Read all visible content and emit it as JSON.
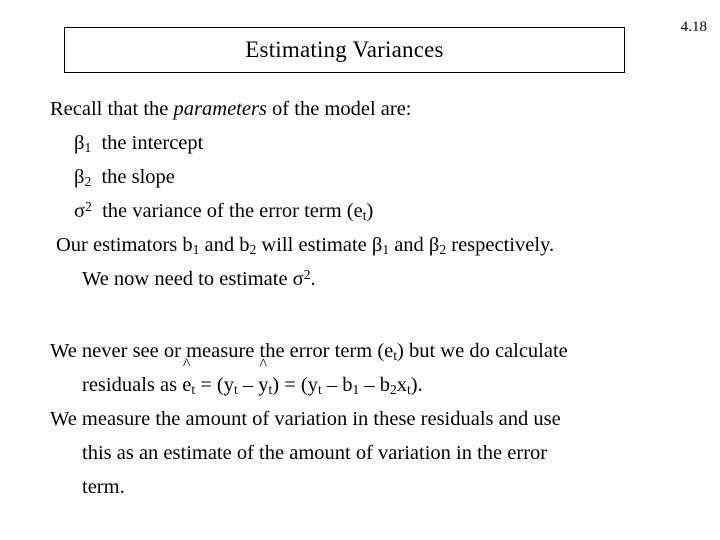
{
  "slide": {
    "number": "4.18",
    "title": "Estimating Variances",
    "background_color": "#ffffff",
    "text_color": "#000000",
    "title_border_color": "#000000"
  },
  "body": {
    "block1": {
      "line1_a": "Recall that the ",
      "line1_italic": "parameters",
      "line1_b": " of the model are:",
      "bullet1": {
        "symbol": "β",
        "sub": "1",
        "text": "the intercept"
      },
      "bullet2": {
        "symbol": "β",
        "sub": "2",
        "text": "the slope"
      },
      "bullet3": {
        "symbol": "σ",
        "sup": "2",
        "text_a": "the variance of the error term (e",
        "sub": "t",
        "text_b": ")"
      },
      "line5_a": "Our estimators b",
      "line5_sub1": "1",
      "line5_b": " and b",
      "line5_sub2": "2",
      "line5_c": " will estimate β",
      "line5_sub3": "1",
      "line5_d": " and β",
      "line5_sub4": "2",
      "line5_e": " respectively.",
      "line6_a": "We now need to estimate σ",
      "line6_sup": "2",
      "line6_b": "."
    },
    "block2": {
      "line1_a": "We never see or measure the error term (e",
      "line1_sub": "t",
      "line1_b": ") but we do calculate",
      "line2_a": "residuals as ",
      "line2_hat1_base": "e",
      "line2_hat1_mark": "^",
      "line2_hat1_sub": "t",
      "line2_b": " = (y",
      "line2_sub1": "t",
      "line2_c": " – ",
      "line2_hat2_base": "y",
      "line2_hat2_mark": "^",
      "line2_hat2_sub": "t",
      "line2_d": ") = (y",
      "line2_sub2": "t",
      "line2_e": " – b",
      "line2_sub3": "1",
      "line2_f": " – b",
      "line2_sub4": "2",
      "line2_g": "x",
      "line2_sub5": "t",
      "line2_h": ").",
      "line3": "We measure the amount of variation in these residuals and use",
      "line4": "this as an estimate of the amount of variation in the error",
      "line5": "term."
    }
  }
}
